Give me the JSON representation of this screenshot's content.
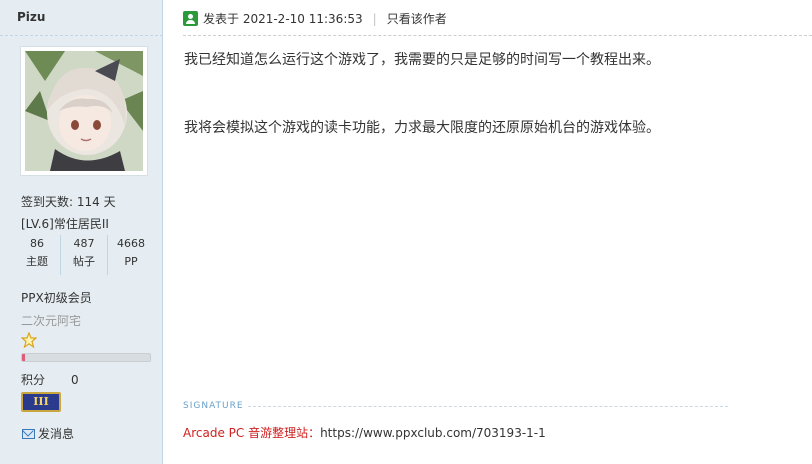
{
  "user": {
    "name": "Pizu",
    "checkin": "签到天数: 114 天",
    "level": "[LV.6]常住居民II",
    "stats": [
      {
        "value": "86",
        "label": "主题"
      },
      {
        "value": "487",
        "label": "帖子"
      },
      {
        "value": "4668",
        "label": "PP"
      }
    ],
    "group": "PPX初级会员",
    "subtitle": "二次元阿宅",
    "progress_fraction": 0.02,
    "points_label": "积分",
    "points_value": "0",
    "medal_text": "III",
    "pm_label": "发消息"
  },
  "post": {
    "posted_label": "发表于 2021-2-10 11:36:53",
    "separator": "|",
    "author_only": "只看该作者",
    "paragraphs": [
      "我已经知道怎么运行这个游戏了，我需要的只是足够的时间写一个教程出来。",
      "我将会模拟这个游戏的读卡功能，力求最大限度的还原原始机台的游戏体验。"
    ],
    "signature_label": "SIGNATURE",
    "signature_title": "Arcade PC 音游整理站：",
    "signature_link": "https://www.ppxclub.com/703193-1-1"
  },
  "colors": {
    "sidebar_bg": "#e5edf2",
    "signature_title": "#d02020",
    "online_icon": "#2b9a3a"
  }
}
